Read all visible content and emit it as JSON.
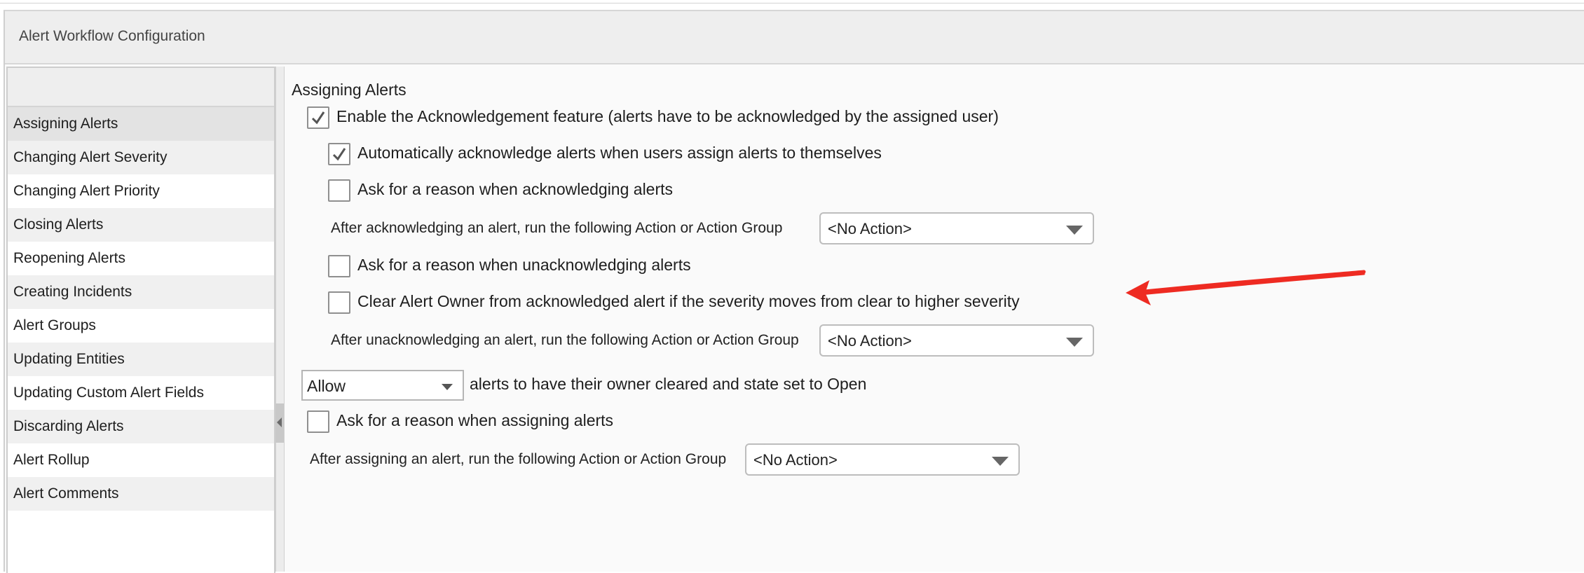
{
  "window": {
    "title": "Alert Workflow Configuration"
  },
  "sidebar": {
    "items": [
      {
        "label": "Assigning Alerts"
      },
      {
        "label": "Changing Alert Severity"
      },
      {
        "label": "Changing Alert Priority"
      },
      {
        "label": "Closing Alerts"
      },
      {
        "label": "Reopening Alerts"
      },
      {
        "label": "Creating Incidents"
      },
      {
        "label": "Alert Groups"
      },
      {
        "label": "Updating Entities"
      },
      {
        "label": "Updating Custom Alert Fields"
      },
      {
        "label": "Discarding Alerts"
      },
      {
        "label": "Alert Rollup"
      },
      {
        "label": "Alert Comments"
      }
    ],
    "selected": "Assigning Alerts"
  },
  "main": {
    "section_title": "Assigning Alerts",
    "enable_ack": {
      "label": "Enable the Acknowledgement feature (alerts have to be acknowledged by the assigned user)",
      "checked": true
    },
    "auto_ack": {
      "label": "Automatically acknowledge alerts when users assign alerts to themselves",
      "checked": true
    },
    "ask_reason_ack": {
      "label": "Ask for a reason when acknowledging alerts",
      "checked": false
    },
    "after_ack": {
      "label": "After acknowledging an alert, run the following Action or Action Group",
      "value": "<No Action>"
    },
    "ask_reason_unack": {
      "label": "Ask for a reason when unacknowledging alerts",
      "checked": false
    },
    "clear_owner": {
      "label": "Clear Alert Owner from acknowledged alert if the severity moves from clear to higher severity",
      "checked": false
    },
    "after_unack": {
      "label": "After unacknowledging an alert, run the following Action or Action Group",
      "value": "<No Action>"
    },
    "allow_select": {
      "value": "Allow",
      "suffix": "alerts to have their owner cleared and state set to Open"
    },
    "ask_reason_assign": {
      "label": "Ask for a reason when assigning alerts",
      "checked": false
    },
    "after_assign": {
      "label": "After assigning an alert, run the following Action or Action Group",
      "value": "<No Action>"
    }
  },
  "colors": {
    "annotation_arrow": "#ee2b22",
    "selected_row": "#e3e3e3"
  }
}
